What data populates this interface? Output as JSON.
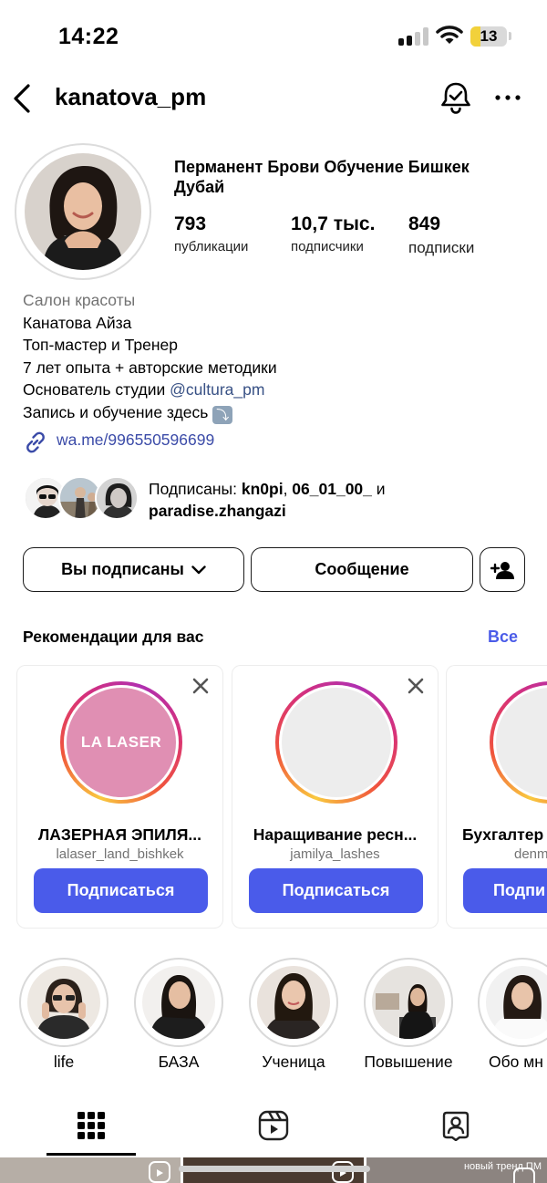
{
  "status_bar": {
    "time": "14:22",
    "battery": "13",
    "battery_level": 0.13
  },
  "header": {
    "username": "kanatova_pm"
  },
  "profile": {
    "name": "Перманент Брови Обучение Бишкек Дубай",
    "stats": [
      {
        "value": "793",
        "label": "публикации"
      },
      {
        "value": "10,7 тыс.",
        "label": "подписчики"
      },
      {
        "value": "849",
        "label": "подписки"
      }
    ]
  },
  "bio": {
    "category": "Салон красоты",
    "line1": "Канатова Айза",
    "line2": "Топ-мастер и Тренер",
    "line3": "7 лет опыта + авторские методики",
    "line4_prefix": "Основатель студии ",
    "line4_mention": "@cultura_pm",
    "line5": "Запись и обучение здесь",
    "line5_emoji": "⤵",
    "link": "wa.me/996550596699"
  },
  "followed_by": {
    "prefix": "Подписаны: ",
    "user1": "kn0pi",
    "sep": ", ",
    "user2": "06_01_00_",
    "and": " и",
    "user3": "paradise.zhangazi"
  },
  "actions": {
    "following_label": "Вы подписаны",
    "message_label": "Сообщение"
  },
  "suggestions": {
    "title": "Рекомендации для вас",
    "see_all": "Все",
    "cards": [
      {
        "name": "ЛАЗЕРНАЯ ЭПИЛЯ...",
        "handle": "lalaser_land_bishkek",
        "logo_text": "LA LASER",
        "follow": "Подписаться"
      },
      {
        "name": "Наращивание ресн...",
        "handle": "jamilya_lashes",
        "follow": "Подписаться"
      },
      {
        "name": "Бухгалтер",
        "handle": "denm",
        "follow": "Подпи"
      }
    ]
  },
  "highlights": [
    {
      "label": "life"
    },
    {
      "label": "БАЗА"
    },
    {
      "label": "Ученица"
    },
    {
      "label": "Повышение"
    },
    {
      "label": "Обо мн"
    }
  ],
  "grid": {
    "caption3": "новый тренд ПМ"
  },
  "colors": {
    "accent": "#4a5bea",
    "link": "#3b4ba8",
    "mention": "#385185"
  }
}
